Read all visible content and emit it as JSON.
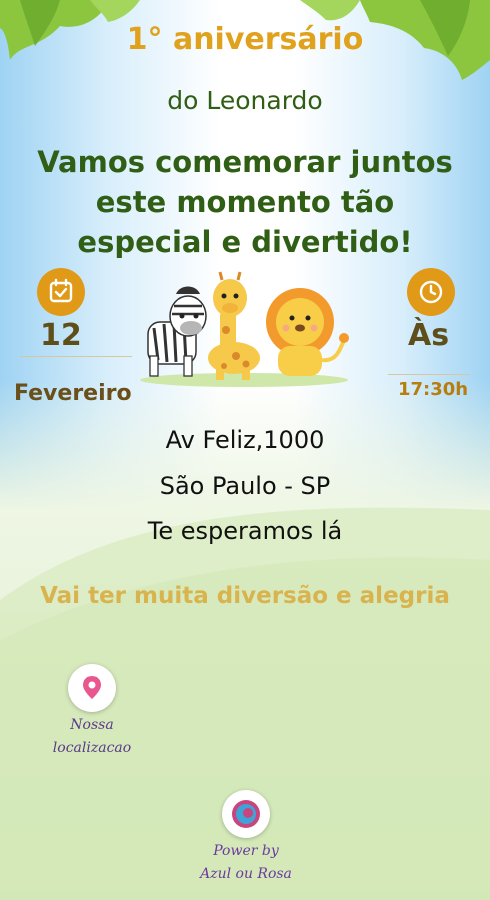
{
  "colors": {
    "accent": "#e09a17",
    "green_text": "#2f5e14",
    "gold_text": "#d9b34d",
    "brown_text": "#5e4e1a",
    "purple_text": "#5a3a8a"
  },
  "invitation": {
    "title": "1° aniversário",
    "subtitle": "do Leonardo",
    "message_lines": [
      "Vamos comemorar juntos",
      "este momento tão",
      "especial e divertido!"
    ]
  },
  "date": {
    "icon": "calendar-icon",
    "day": "12",
    "month": "Fevereiro"
  },
  "time": {
    "icon": "clock-icon",
    "prefix": "Às",
    "value": "17:30h"
  },
  "illustration": {
    "animals": [
      "zebra",
      "giraffe",
      "lion"
    ]
  },
  "address": {
    "street": "Av Feliz,1000",
    "city": "São Paulo - SP",
    "invite": "Te esperamos lá"
  },
  "tagline": "Vai ter muita diversão e alegria",
  "location_button": {
    "icon": "map-pin-icon",
    "line1": "Nossa",
    "line2": "localizacao"
  },
  "footer": {
    "icon": "brand-logo-icon",
    "line1": "Power  by",
    "line2": "Azul  ou  Rosa"
  }
}
